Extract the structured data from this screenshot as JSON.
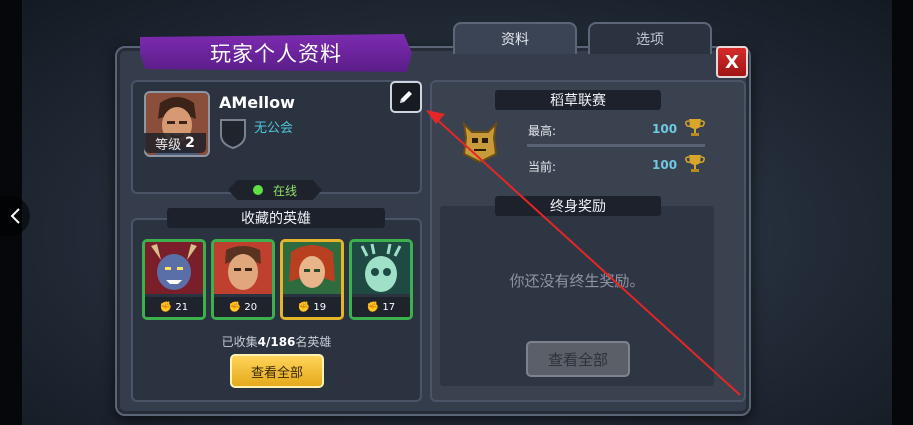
{
  "window": {
    "title": "玩家个人资料"
  },
  "tabs": [
    {
      "label": "资料",
      "active": true
    },
    {
      "label": "选项",
      "active": false
    }
  ],
  "close_icon_text": "X",
  "player": {
    "name": "AMellow",
    "level_label": "等级",
    "level": "2",
    "guild": "无公会",
    "status": "在线"
  },
  "heroes": {
    "header": "收藏的英雄",
    "items": [
      {
        "name_icon": "demon-hero",
        "level": "21"
      },
      {
        "name_icon": "warrior-hero",
        "level": "20"
      },
      {
        "name_icon": "elf-archer-hero",
        "level": "19"
      },
      {
        "name_icon": "spirit-hero",
        "level": "17"
      }
    ],
    "collected_prefix": "已收集",
    "collected_count": "4/186",
    "collected_suffix": "名英雄",
    "view_all": "查看全部"
  },
  "league": {
    "header": "稻草联赛",
    "highest_label": "最高:",
    "highest_value": "100",
    "current_label": "当前:",
    "current_value": "100"
  },
  "awards": {
    "header": "终身奖励",
    "empty_text": "你还没有终生奖励。",
    "view_all": "查看全部"
  },
  "colors": {
    "accent_purple": "#6a24a0",
    "online_green": "#5fe044",
    "gold_button": "#f2c13a",
    "close_red": "#c41f1f"
  }
}
